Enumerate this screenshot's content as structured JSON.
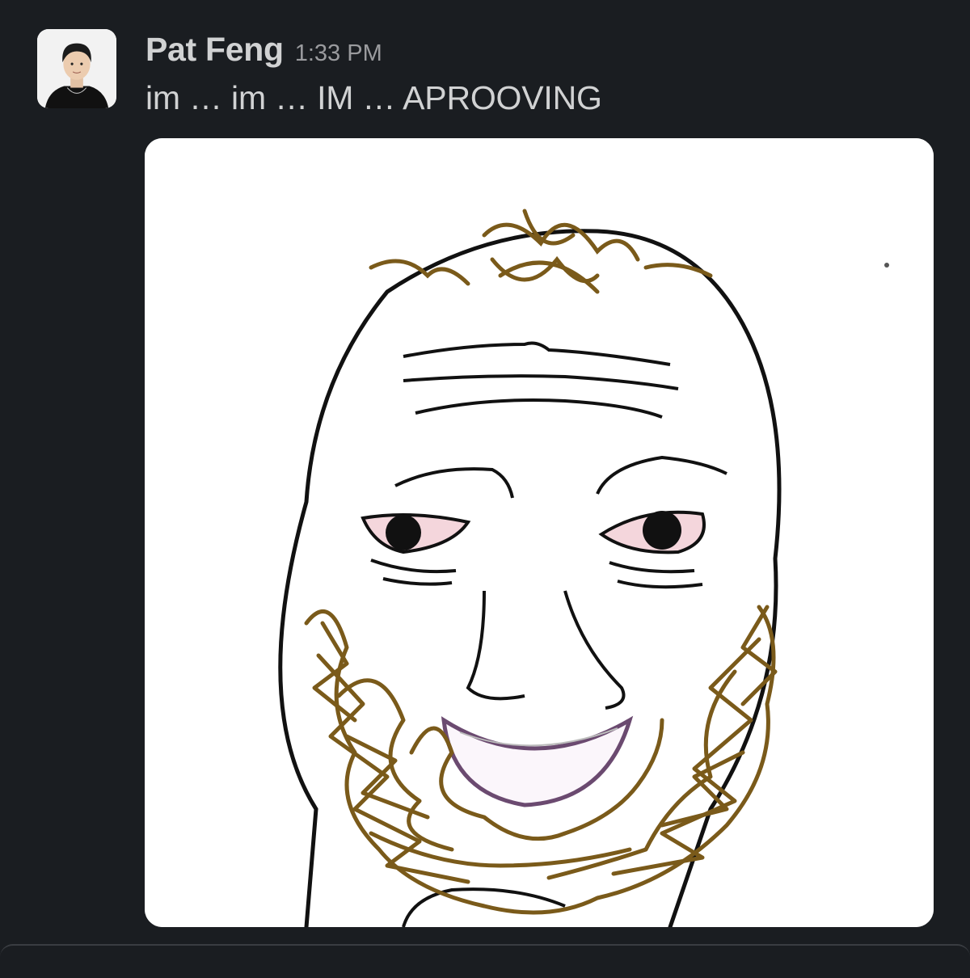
{
  "message": {
    "sender_name": "Pat Feng",
    "timestamp": "1:33 PM",
    "text": "im … im … IM … APROOVING",
    "avatar_icon": "user-avatar-photo",
    "attachment_icon": "bearded-wojak-meme-image"
  },
  "colors": {
    "background": "#1a1d21",
    "text_primary": "#d1d2d3",
    "text_secondary": "#9a9b9e",
    "beard": "#7a5a1a"
  }
}
